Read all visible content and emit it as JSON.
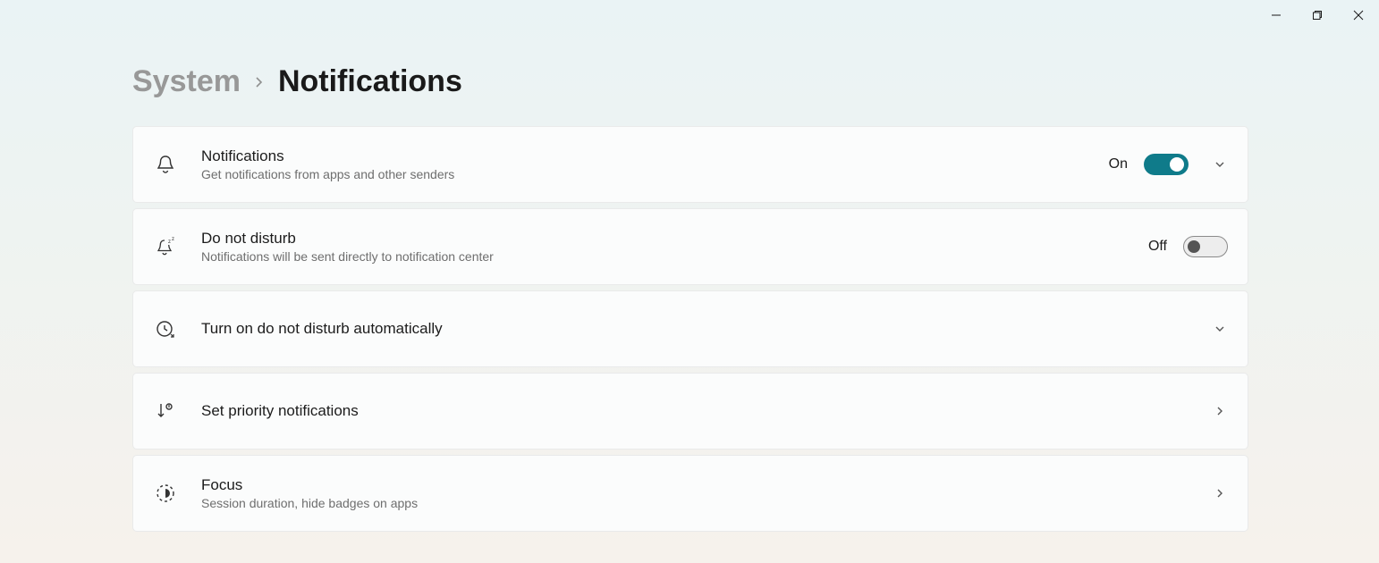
{
  "breadcrumb": {
    "parent": "System",
    "current": "Notifications"
  },
  "cards": {
    "notifications": {
      "title": "Notifications",
      "subtitle": "Get notifications from apps and other senders",
      "state": "On"
    },
    "do_not_disturb": {
      "title": "Do not disturb",
      "subtitle": "Notifications will be sent directly to notification center",
      "state": "Off"
    },
    "dnd_auto": {
      "title": "Turn on do not disturb automatically"
    },
    "priority": {
      "title": "Set priority notifications"
    },
    "focus": {
      "title": "Focus",
      "subtitle": "Session duration, hide badges on apps"
    }
  }
}
